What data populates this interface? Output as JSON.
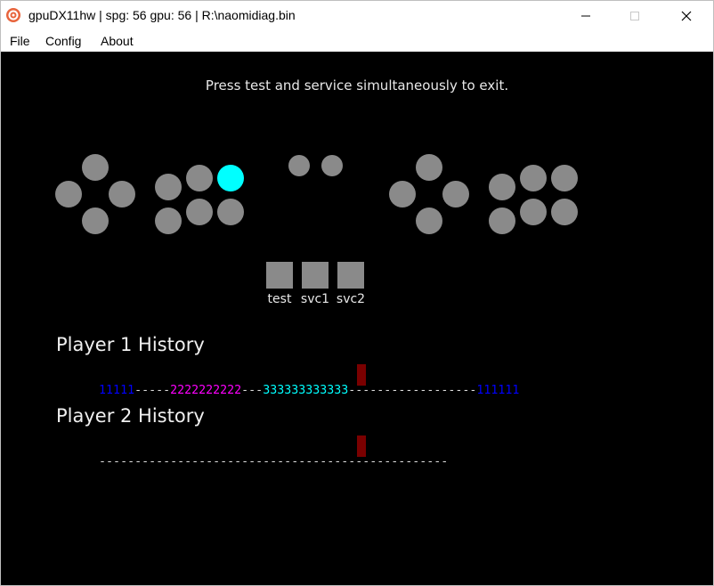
{
  "window": {
    "title": "gpuDX11hw | spg: 56 gpu: 56 | R:\\naomidiag.bin",
    "icon": "flycast-logo-icon",
    "controls": [
      "minimize-icon",
      "maximize-icon",
      "close-icon"
    ]
  },
  "menu": {
    "file": "File",
    "config": "Config",
    "about": "About"
  },
  "screen": {
    "instruction": "Press test and service simultaneously to exit.",
    "active_color": "#00ffff",
    "inactive_color": "#8a8a8a",
    "marker_color": "#7a0000",
    "player1_buttons": {
      "pressed": 1
    },
    "system_buttons": {
      "test": "test",
      "svc1": "svc1",
      "svc2": "svc2"
    }
  },
  "history": {
    "player1": {
      "title": "Player 1 History",
      "segments": [
        {
          "text": "11111",
          "color": "#0000ff"
        },
        {
          "text": "-----",
          "color": "#dcdcdc"
        },
        {
          "text": "2222222222",
          "color": "#ff00ff"
        },
        {
          "text": "---",
          "color": "#dcdcdc"
        },
        {
          "text": "333333333333",
          "color": "#00ffff"
        },
        {
          "text": "------------------",
          "color": "#dcdcdc"
        },
        {
          "text": "111111",
          "color": "#0000ff"
        }
      ]
    },
    "player2": {
      "title": "Player 2 History",
      "segments": [
        {
          "text": "-------------------------------------------------",
          "color": "#dcdcdc"
        }
      ]
    }
  }
}
